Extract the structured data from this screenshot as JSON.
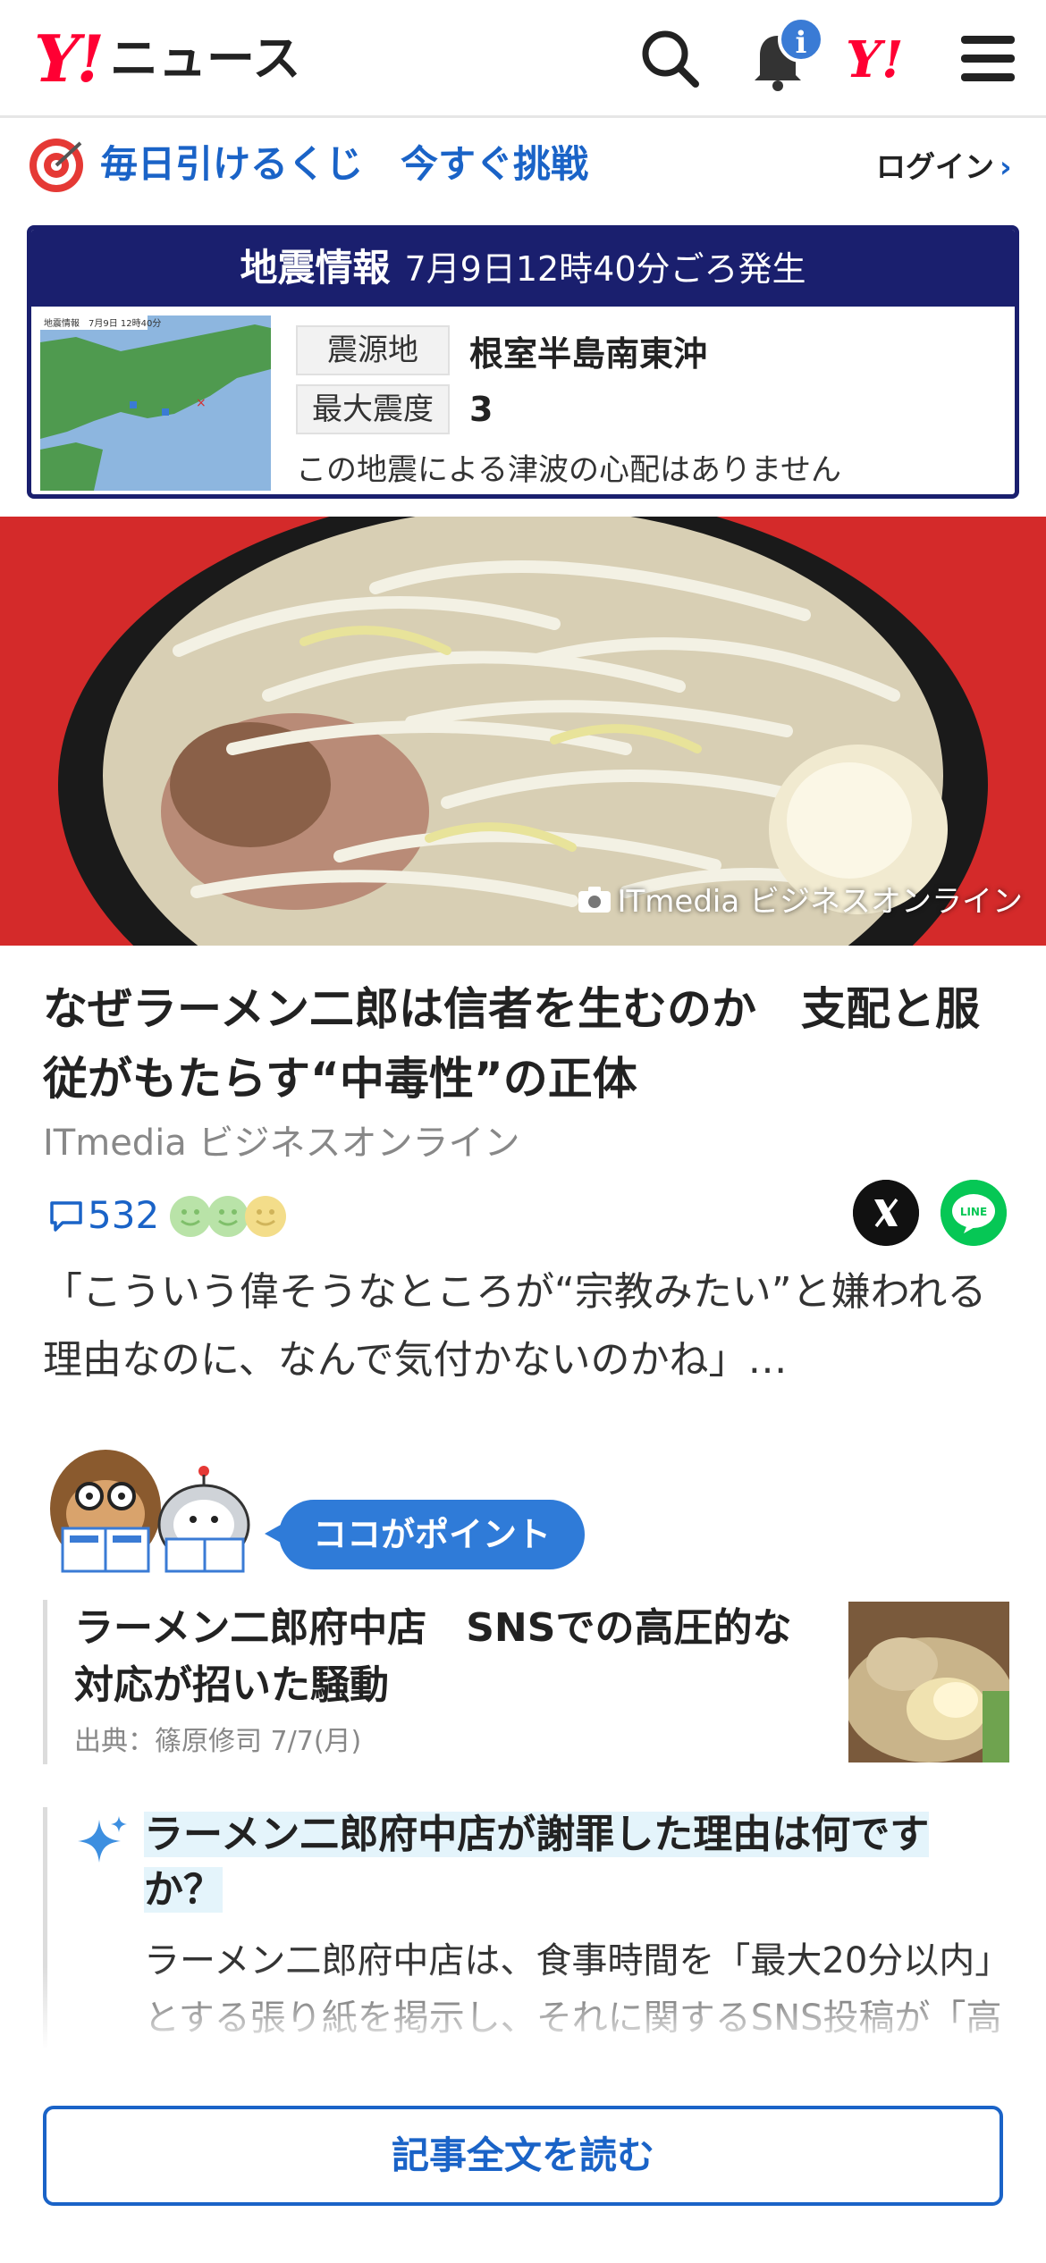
{
  "header": {
    "logo_y": "Y!",
    "logo_text": "ニュース",
    "notification_badge": "i",
    "yahoo_icon": "Y!",
    "icons": [
      "search-icon",
      "bell-icon",
      "yahoo-japan-icon",
      "hamburger-menu-icon"
    ]
  },
  "promo": {
    "text": "毎日引けるくじ　今すぐ挑戦",
    "login": "ログイン",
    "login_chevron": "›"
  },
  "earthquake": {
    "title": "地震情報",
    "time": "7月9日12時40分ごろ発生",
    "map_label": "地震情報　7月9日 12時40分",
    "epicenter_label": "震源地",
    "epicenter_value": "根室半島南東沖",
    "intensity_label": "最大震度",
    "intensity_value": "3",
    "note": "この地震による津波の心配はありません"
  },
  "hero": {
    "credit": "ITmedia ビジネスオンライン"
  },
  "article": {
    "title": "なぜラーメン二郎は信者を生むのか　支配と服従がもたらす“中毒性”の正体",
    "source": "ITmedia ビジネスオンライン",
    "comment_count": "532",
    "excerpt": "「こういう偉そうなところが“宗教みたい”と嫌われる理由なのに、なんで気付かないのかね」…"
  },
  "point": {
    "label": "ココがポイント",
    "related_title": "ラーメン二郎府中店　SNSでの高圧的な対応が招いた騒動",
    "related_source": "出典：篠原修司 7/7(月)",
    "question": "ラーメン二郎府中店が謝罪した理由は何ですか？",
    "answer": "ラーメン二郎府中店は、食事時間を「最大20分以内」とする張り紙を掲示し、それに関するSNS投稿が「高圧的」と受け取られたため、謝罪しました。"
  },
  "read_more": "記事全文を読む",
  "colors": {
    "brand_red": "#ff0033",
    "link_blue": "#1a63c7",
    "quake_navy": "#1a1f6e",
    "line_green": "#06c755"
  }
}
